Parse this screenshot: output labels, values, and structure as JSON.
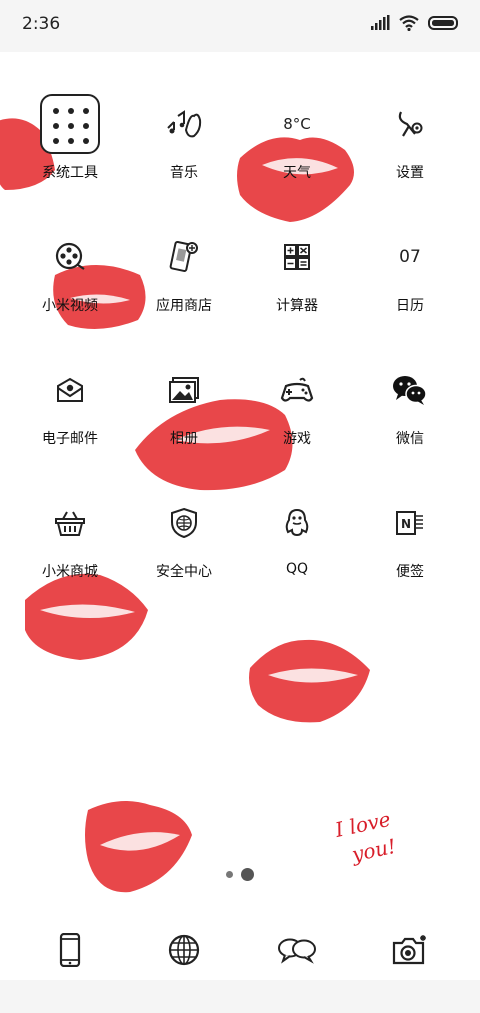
{
  "status_bar": {
    "time": "2:36"
  },
  "apps": [
    {
      "id": "system-tools",
      "label": "系统工具"
    },
    {
      "id": "music",
      "label": "音乐"
    },
    {
      "id": "weather",
      "label": "天气",
      "icon_text": "8°C"
    },
    {
      "id": "settings",
      "label": "设置"
    },
    {
      "id": "mi-video",
      "label": "小米视频"
    },
    {
      "id": "app-store",
      "label": "应用商店"
    },
    {
      "id": "calculator",
      "label": "计算器"
    },
    {
      "id": "calendar",
      "label": "日历",
      "icon_text": "07"
    },
    {
      "id": "email",
      "label": "电子邮件"
    },
    {
      "id": "gallery",
      "label": "相册"
    },
    {
      "id": "games",
      "label": "游戏"
    },
    {
      "id": "wechat",
      "label": "微信"
    },
    {
      "id": "mi-store",
      "label": "小米商城"
    },
    {
      "id": "security",
      "label": "安全中心"
    },
    {
      "id": "qq",
      "label": "QQ"
    },
    {
      "id": "notes",
      "label": "便签"
    }
  ],
  "wallpaper": {
    "text_line1": "I love",
    "text_line2": "you!",
    "lip_color": "#e8474a"
  },
  "dock": [
    {
      "id": "phone",
      "icon": "phone-icon"
    },
    {
      "id": "browser",
      "icon": "globe-icon"
    },
    {
      "id": "messages",
      "icon": "chat-bubbles-icon"
    },
    {
      "id": "camera",
      "icon": "camera-icon"
    }
  ],
  "pager": {
    "pages": 2,
    "current": 2
  }
}
